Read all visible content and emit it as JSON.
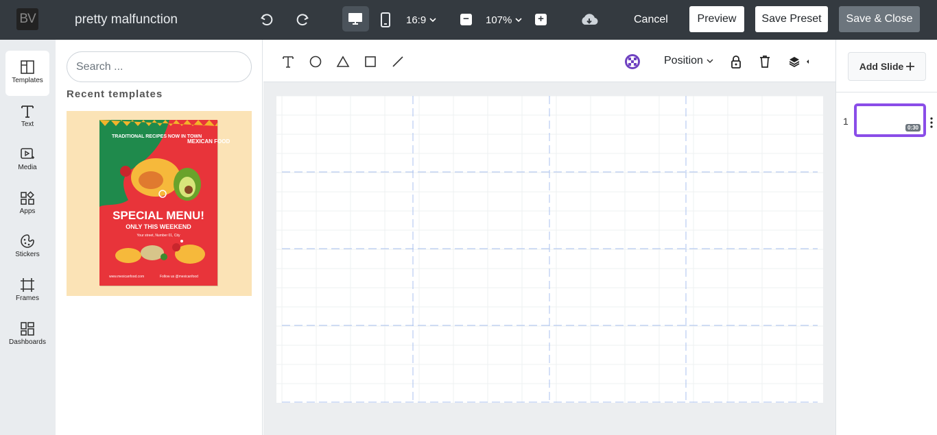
{
  "header": {
    "logo_text": "BV",
    "doc_title": "pretty malfunction",
    "aspect_ratio": "16:9",
    "zoom": "107%",
    "cancel_label": "Cancel",
    "preview_label": "Preview",
    "save_preset_label": "Save Preset",
    "save_close_label": "Save & Close",
    "icons": [
      "undo-icon",
      "redo-icon",
      "desktop-icon",
      "mobile-icon",
      "zoom-out-icon",
      "zoom-in-icon",
      "cloud-download-icon"
    ]
  },
  "rail": {
    "items": [
      {
        "label": "Templates",
        "icon": "templates-icon",
        "active": true
      },
      {
        "label": "Text",
        "icon": "text-icon"
      },
      {
        "label": "Media",
        "icon": "media-icon"
      },
      {
        "label": "Apps",
        "icon": "apps-icon"
      },
      {
        "label": "Stickers",
        "icon": "stickers-icon"
      },
      {
        "label": "Frames",
        "icon": "frames-icon"
      },
      {
        "label": "Dashboards",
        "icon": "dashboards-icon"
      }
    ]
  },
  "panel": {
    "search_placeholder": "Search ...",
    "recent_label": "Recent templates",
    "template": {
      "headline_left": "TRADITIONAL RECIPES NOW IN TOWN",
      "brand": "MEXICAN FOOD",
      "title": "SPECIAL MENU!",
      "subtitle": "ONLY THIS WEEKEND",
      "address": "Your street, Number 01, City",
      "website": "www.mexicanfood.com",
      "social": "Follow us @mexicanfood"
    }
  },
  "editor": {
    "position_label": "Position",
    "tools": [
      "text-tool-icon",
      "circle-tool-icon",
      "triangle-tool-icon",
      "rectangle-tool-icon",
      "line-tool-icon"
    ],
    "colors": {
      "accent": "#8a4de8",
      "guide": "#a8c0ef"
    }
  },
  "slides": {
    "add_label": "Add Slide",
    "items": [
      {
        "number": "1",
        "duration": "0:30"
      }
    ]
  }
}
